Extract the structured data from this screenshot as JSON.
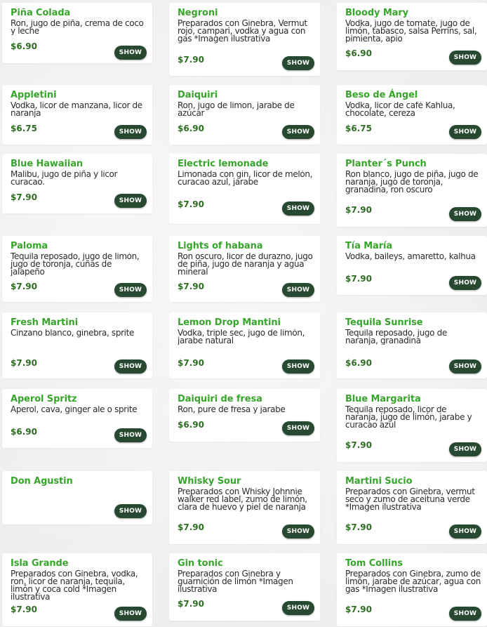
{
  "menu": {
    "items": [
      {
        "name": "Piña Colada",
        "description": "Ron, jugo de piña, crema de coco y leche",
        "price": "$6.90",
        "button": "SHOW"
      },
      {
        "name": "Negroni",
        "description": "Preparados con Ginebra, Vermut rojo, campari, vodka y agua con gas *Imagen ilustrativa",
        "price": "$7.90",
        "button": "SHOW"
      },
      {
        "name": "Bloody Mary",
        "description": "Vodka, jugo de tomate, jugo de limón, tabasco, salsa Perrins, sal, pimienta, apio",
        "price": "$6.90",
        "button": "SHOW"
      },
      {
        "name": "Appletini",
        "description": "Vodka, licor de manzana, licor de naranja",
        "price": "$6.75",
        "button": "SHOW"
      },
      {
        "name": "Daiquiri",
        "description": "Ron, jugo de limon, jarabe de azúcar",
        "price": "$6.90",
        "button": "SHOW"
      },
      {
        "name": "Beso de Ángel",
        "description": "Vodka, licor de café Kahlua, chocolate, cereza",
        "price": "$6.75",
        "button": "SHOW"
      },
      {
        "name": "Blue Hawaiian",
        "description": "Malibu, jugo de piña y licor curacao.",
        "price": "$7.90",
        "button": "SHOW"
      },
      {
        "name": "Electric lemonade",
        "description": "Limonada con gin, licor de melón, curacao azul, jarabe",
        "price": "$7.90",
        "button": "SHOW"
      },
      {
        "name": "Planter´s Punch",
        "description": "Ron blanco, jugo de piña, jugo de naranja, jugo de toronja, granadina, ron oscuro",
        "price": "$7.90",
        "button": "SHOW"
      },
      {
        "name": "Paloma",
        "description": "Tequila reposado, jugo de limón, jugo de toronja, cuñas de jalapeño",
        "price": "$7.90",
        "button": "SHOW"
      },
      {
        "name": "Lights of habana",
        "description": "Ron oscuro, licor de durazno, jugo de piña, jugo de naranja y agua mineral",
        "price": "$7.90",
        "button": "SHOW"
      },
      {
        "name": "Tía María",
        "description": "Vodka, baileys, amaretto, kalhua",
        "price": "$7.90",
        "button": "SHOW"
      },
      {
        "name": "Fresh Martini",
        "description": "Cinzano blanco, ginebra, sprite",
        "price": "$7.90",
        "button": "SHOW"
      },
      {
        "name": "Lemon Drop Mantini",
        "description": "Vodka, triple sec, jugo de limón, jarabe natural",
        "price": "$7.90",
        "button": "SHOW"
      },
      {
        "name": "Tequila Sunrise",
        "description": "Tequila reposado, jugo de naranja, granadina",
        "price": "$6.90",
        "button": "SHOW"
      },
      {
        "name": "Aperol Spritz",
        "description": "Aperol, cava, ginger ale o sprite",
        "price": "$6.90",
        "button": "SHOW"
      },
      {
        "name": "Daiquiri de fresa",
        "description": "Ron, pure de fresa y jarabe",
        "price": "$6.90",
        "button": "SHOW"
      },
      {
        "name": "Blue Margarita",
        "description": "Tequila reposado, licor de naranja, jugo de limón, jarabe y curacao azul",
        "price": "$7.90",
        "button": "SHOW"
      },
      {
        "name": "Don Agustin",
        "description": "",
        "price": "",
        "button": "SHOW"
      },
      {
        "name": "Whisky Sour",
        "description": "Preparados con Whisky Johnnie walker red label, zumo de limón, clara de huevo y piel de naranja",
        "price": "$7.90",
        "button": "SHOW"
      },
      {
        "name": "Martini Sucio",
        "description": "Preparados con Ginebra, vermut seco y zumo de aceituna verde *Imagen ilustrativa",
        "price": "$7.90",
        "button": "SHOW"
      },
      {
        "name": "Isla Grande",
        "description": "Preparados con Ginebra, vodka, ron, licor de naranja, tequila, limón y coca cold *Imagen ilustrativa",
        "price": "$7.90",
        "button": "SHOW"
      },
      {
        "name": "Gin tonic",
        "description": "Preparados con Ginebra y guarnición de limón *Imagen ilustrativa",
        "price": "$7.90",
        "button": "SHOW"
      },
      {
        "name": "Tom Collins",
        "description": "Preparados con Ginebra, zumo de limón, jarabe de azúcar, agua con gas *Imagen ilustrativa",
        "price": "$7.90",
        "button": "SHOW"
      }
    ]
  },
  "colors": {
    "item_name": "#37a52b",
    "price": "#2e6e22",
    "button_bg": "#26492f",
    "button_text": "#ffffff",
    "card_bg": "#ffffff"
  }
}
